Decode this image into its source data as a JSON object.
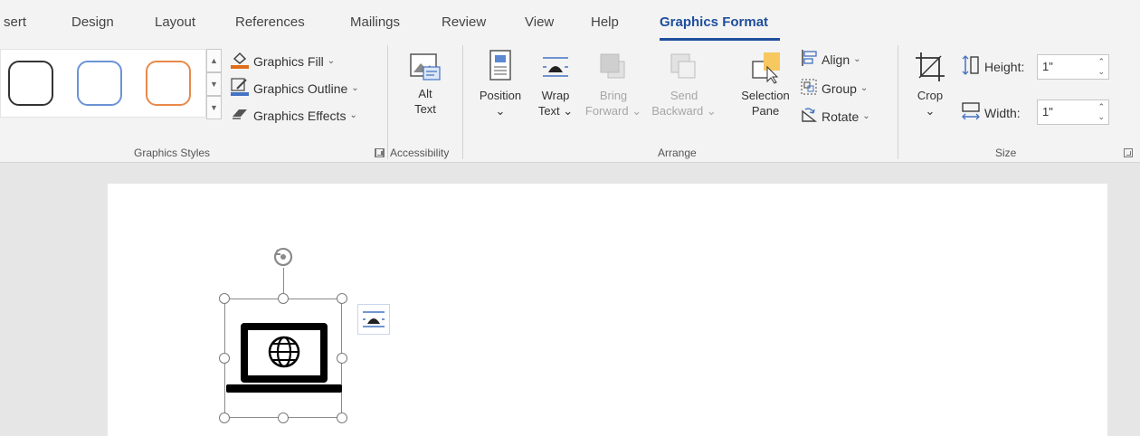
{
  "tabs": [
    {
      "label": "sert"
    },
    {
      "label": "Design"
    },
    {
      "label": "Layout"
    },
    {
      "label": "References"
    },
    {
      "label": "Mailings"
    },
    {
      "label": "Review"
    },
    {
      "label": "View"
    },
    {
      "label": "Help"
    },
    {
      "label": "Graphics Format",
      "active": true
    }
  ],
  "graphics_styles": {
    "fill": "Graphics Fill",
    "outline": "Graphics Outline",
    "effects": "Graphics Effects",
    "group_label": "Graphics Styles",
    "swatch_colors": [
      "#333333",
      "#6b93d6",
      "#e8894a"
    ]
  },
  "accessibility": {
    "alt_line1": "Alt",
    "alt_line2": "Text",
    "group_label": "Accessibility"
  },
  "arrange": {
    "position": "Position",
    "wrap_line1": "Wrap",
    "wrap_line2": "Text",
    "bring_line1": "Bring",
    "bring_line2": "Forward",
    "send_line1": "Send",
    "send_line2": "Backward",
    "selection_line1": "Selection",
    "selection_line2": "Pane",
    "align": "Align",
    "group": "Group",
    "rotate": "Rotate",
    "group_label": "Arrange"
  },
  "size": {
    "crop": "Crop",
    "height_label": "Height:",
    "height_value": "1\"",
    "width_label": "Width:",
    "width_value": "1\"",
    "group_label": "Size"
  },
  "colors": {
    "accent": "#1e4e9c",
    "fill_bar": "#e06c1a",
    "outline_bar": "#4472c4"
  }
}
